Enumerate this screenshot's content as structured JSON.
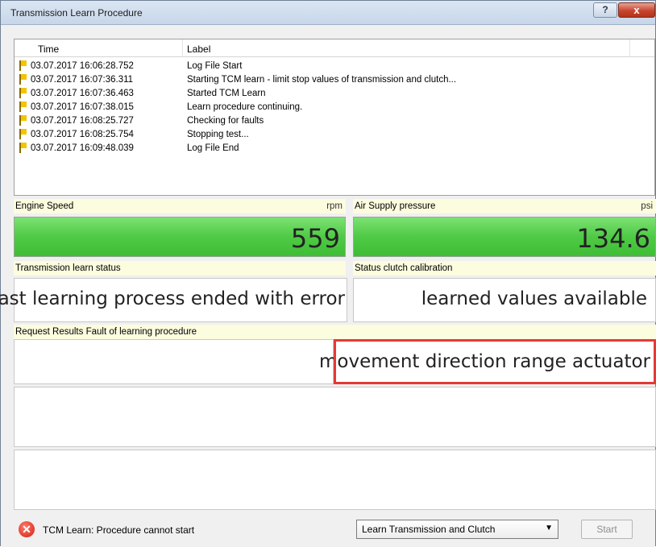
{
  "window": {
    "title": "Transmission Learn Procedure",
    "help_glyph": "?",
    "close_glyph": "x"
  },
  "log": {
    "columns": {
      "time": "Time",
      "label": "Label"
    },
    "rows": [
      {
        "time": "03.07.2017 16:06:28.752",
        "label": "Log File Start"
      },
      {
        "time": "03.07.2017 16:07:36.311",
        "label": "Starting TCM learn - limit stop values of transmission and clutch..."
      },
      {
        "time": "03.07.2017 16:07:36.463",
        "label": "Started TCM Learn"
      },
      {
        "time": "03.07.2017 16:07:38.015",
        "label": "Learn procedure continuing."
      },
      {
        "time": "03.07.2017 16:08:25.727",
        "label": "Checking for faults"
      },
      {
        "time": "03.07.2017 16:08:25.754",
        "label": "Stopping test..."
      },
      {
        "time": "03.07.2017 16:09:48.039",
        "label": "Log File End"
      }
    ]
  },
  "engine_speed": {
    "label": "Engine Speed",
    "unit": "rpm",
    "value": "559"
  },
  "air_supply": {
    "label": "Air Supply pressure",
    "unit": "psi",
    "value": "134.6"
  },
  "trans_status": {
    "label": "Transmission learn status",
    "value": "last learning process ended with error"
  },
  "clutch_status": {
    "label": "Status clutch calibration",
    "value": "learned values available"
  },
  "fault": {
    "label": "Request Results Fault of learning procedure",
    "value": "movement direction range actuator"
  },
  "status": {
    "message": "TCM Learn: Procedure cannot start",
    "error_glyph": "✕"
  },
  "mode_select": {
    "selected": "Learn Transmission and Clutch",
    "arrow": "▼"
  },
  "start_button": {
    "label": "Start"
  },
  "colors": {
    "green": "#4fca45",
    "highlight": "#e53935",
    "caption_bg": "#fcfcdf"
  }
}
